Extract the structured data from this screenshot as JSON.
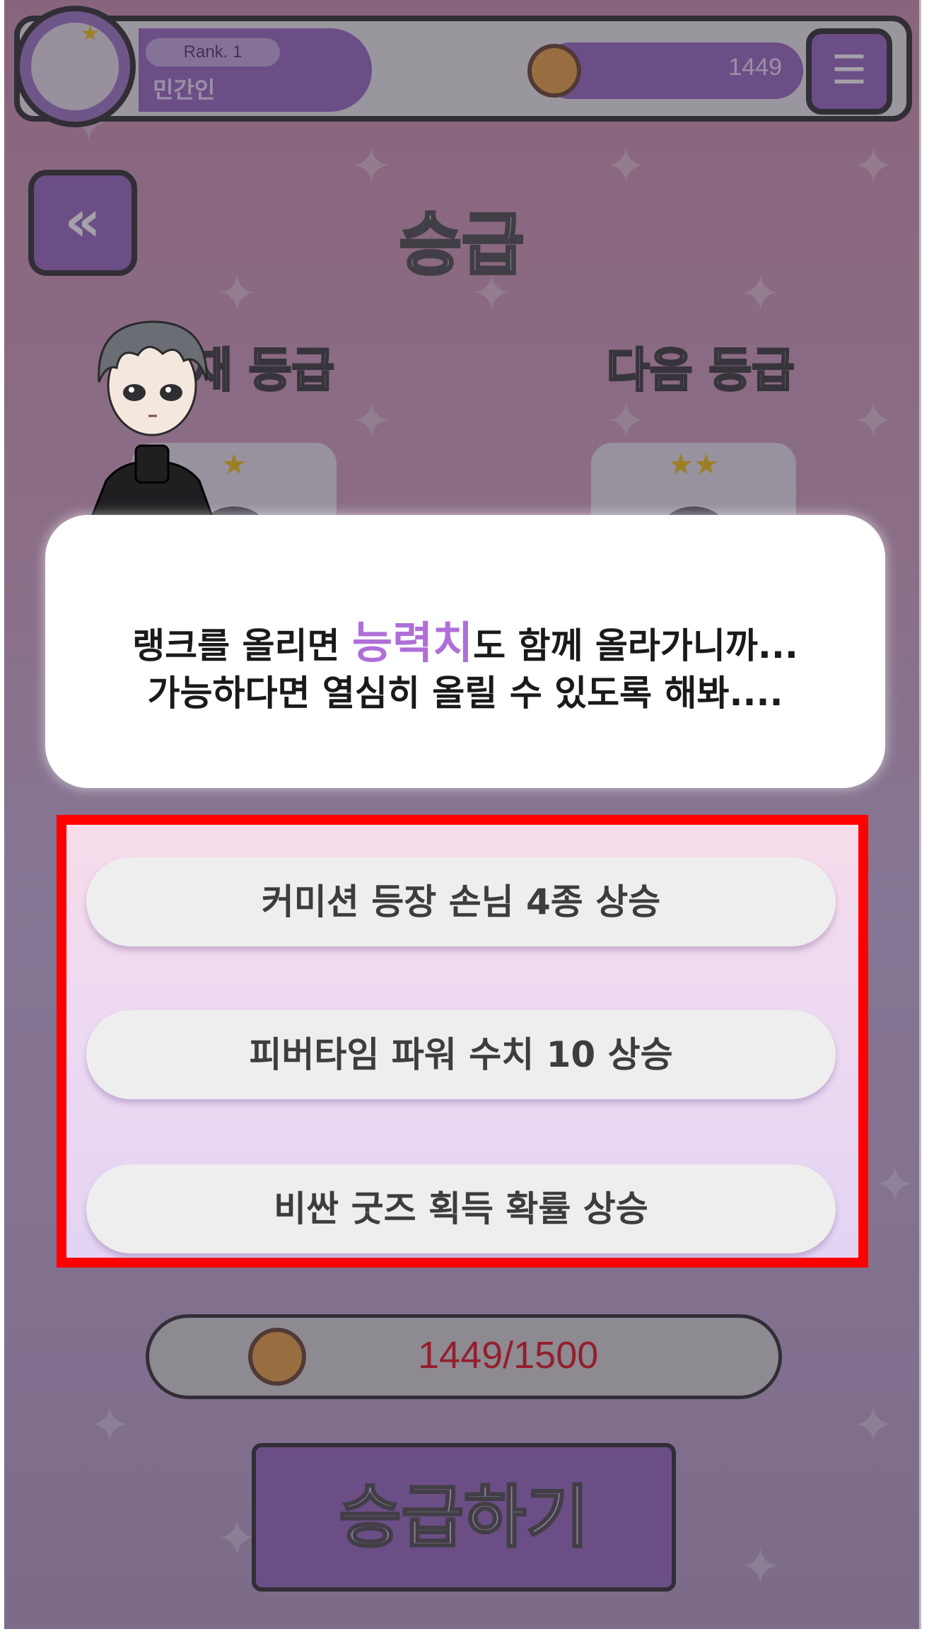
{
  "header": {
    "rank_label": "Rank. 1",
    "rank_name": "민간인",
    "coin_amount": "1449",
    "menu_icon": "list-icon"
  },
  "page": {
    "back_icon": "double-chevron-left-icon",
    "title": "승급",
    "current_grade_label": "재 등급",
    "next_grade_label": "다음 등급",
    "current_grade_stars": "★",
    "next_grade_stars": "★★"
  },
  "dialogue": {
    "line1_before": "랭크를 올리면 ",
    "line1_highlight": "능력치",
    "line1_after": "도 함께 올라가니까...",
    "line2": "가능하다면 열심히 올릴 수 있도록 해봐...."
  },
  "benefits": [
    "커미션 등장 손님 4종 상승",
    "피버타임 파워 수치 10 상승",
    "비싼 굿즈 획득 확률 상승"
  ],
  "cost": {
    "text": "1449/1500"
  },
  "promote_button": {
    "label": "승급하기"
  },
  "colors": {
    "accent": "#9d71c4",
    "highlight": "#b06fd8",
    "cost_insufficient": "#e0202a",
    "annotation_box": "#ff0000"
  }
}
